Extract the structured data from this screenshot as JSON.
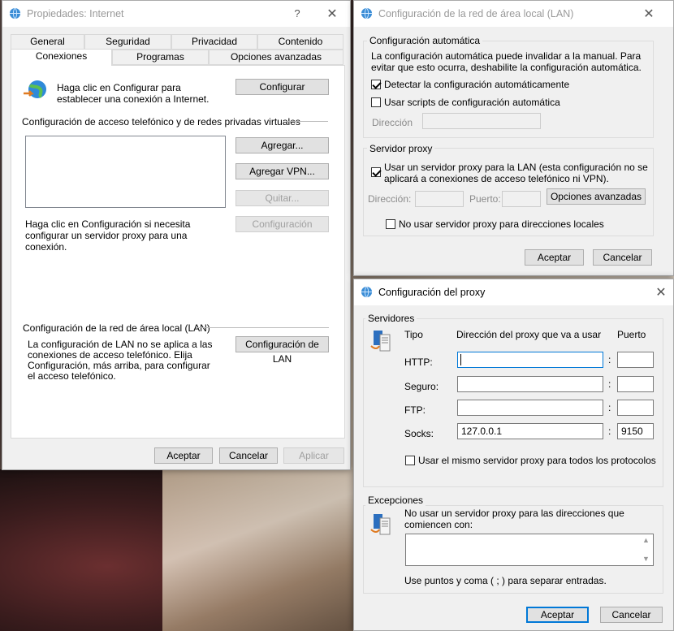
{
  "background": {
    "description_colors": [
      "#3a1c1d",
      "#e9dccb"
    ]
  },
  "internet_props": {
    "title": "Propiedades: Internet",
    "help": "?",
    "close": "✕",
    "tabs_row1": [
      "General",
      "Seguridad",
      "Privacidad",
      "Contenido"
    ],
    "tabs_row2": [
      "Conexiones",
      "Programas",
      "Opciones avanzadas"
    ],
    "setup_text": "Haga clic en Configurar para establecer una conexión a Internet.",
    "setup_btn": "Configurar",
    "dialup_header": "Configuración de acceso telefónico y de redes privadas virtuales",
    "add_btn": "Agregar...",
    "add_vpn_btn": "Agregar VPN...",
    "remove_btn": "Quitar...",
    "config_btn": "Configuración",
    "proxy_hint": "Haga clic en Configuración si necesita configurar un servidor proxy para una conexión.",
    "lan_header": "Configuración de la red de área local (LAN)",
    "lan_text": "La configuración de LAN no se aplica a las conexiones de acceso telefónico. Elija Configuración, más arriba, para configurar el acceso telefónico.",
    "lan_btn": "Configuración de LAN",
    "ok": "Aceptar",
    "cancel": "Cancelar",
    "apply": "Aplicar"
  },
  "lan_settings": {
    "title": "Configuración de la red de área local (LAN)",
    "close": "✕",
    "auto_group": "Configuración automática",
    "auto_text": "La configuración automática puede invalidar a la manual. Para evitar que esto ocurra, deshabilite la configuración automática.",
    "detect_label": "Detectar la configuración automáticamente",
    "detect_checked": true,
    "script_label": "Usar scripts de configuración automática",
    "script_checked": false,
    "address_label": "Dirección",
    "proxy_group": "Servidor proxy",
    "use_proxy_label": "Usar un servidor proxy para la LAN (esta configuración no se aplicará a conexiones de acceso telefónico ni VPN).",
    "use_proxy_checked": true,
    "proxy_address_label": "Dirección:",
    "port_label": "Puerto:",
    "advanced_btn": "Opciones avanzadas",
    "bypass_label": "No usar servidor proxy para direcciones locales",
    "bypass_checked": false,
    "ok": "Aceptar",
    "cancel": "Cancelar"
  },
  "proxy_settings": {
    "title": "Configuración del proxy",
    "close": "✕",
    "servers_group": "Servidores",
    "col_type": "Tipo",
    "col_address": "Dirección del proxy que va a usar",
    "col_port": "Puerto",
    "rows": [
      {
        "type": "HTTP:",
        "address": "",
        "port": ""
      },
      {
        "type": "Seguro:",
        "address": "",
        "port": ""
      },
      {
        "type": "FTP:",
        "address": "",
        "port": ""
      },
      {
        "type": "Socks:",
        "address": "127.0.0.1",
        "port": "9150"
      }
    ],
    "colon": ":",
    "same_proxy_label": "Usar el mismo servidor proxy para todos los protocolos",
    "same_proxy_checked": false,
    "exceptions_group": "Excepciones",
    "exceptions_text": "No usar un servidor proxy para las direcciones que comiencen con:",
    "exceptions_value": "",
    "exceptions_hint": "Use puntos y coma ( ; ) para separar entradas.",
    "ok": "Aceptar",
    "cancel": "Cancelar"
  }
}
